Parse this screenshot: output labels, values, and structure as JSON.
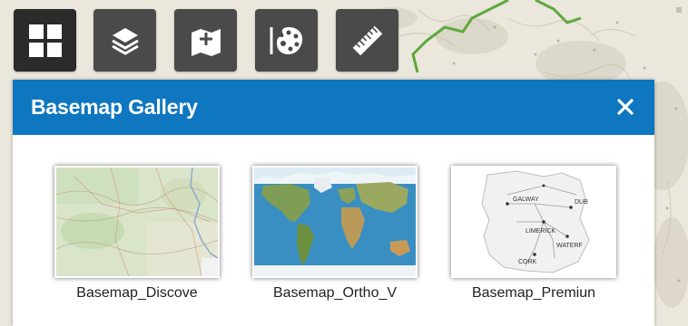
{
  "toolbar": {
    "buttons": [
      {
        "icon": "basemap-gallery-icon",
        "active": true
      },
      {
        "icon": "layers-icon",
        "active": false
      },
      {
        "icon": "add-data-icon",
        "active": false
      },
      {
        "icon": "palette-icon",
        "active": false
      },
      {
        "icon": "measure-ruler-icon",
        "active": false
      }
    ]
  },
  "panel": {
    "title": "Basemap Gallery",
    "close_icon": "close-icon",
    "header_color": "#0f76c0"
  },
  "gallery": {
    "items": [
      {
        "label": "Basemap_Discove",
        "thumbnail": "topographic-map-thumbnail"
      },
      {
        "label": "Basemap_Ortho_V",
        "thumbnail": "world-imagery-thumbnail"
      },
      {
        "label": "Basemap_Premiun",
        "thumbnail": "premium-road-map-thumbnail"
      }
    ],
    "map_labels": [
      "GALWAY",
      "DUB",
      "LIMERICK",
      "WATERF",
      "CORK"
    ]
  }
}
